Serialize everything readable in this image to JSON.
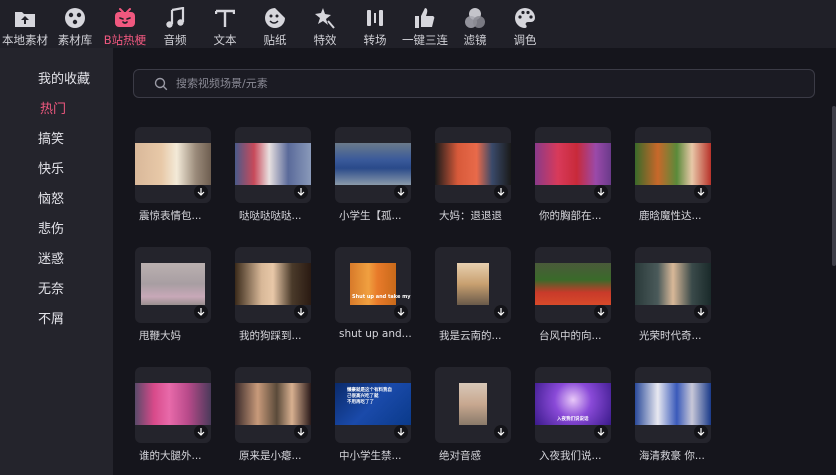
{
  "toolbar": [
    {
      "label": "本地素材",
      "icon": "local-media-icon"
    },
    {
      "label": "素材库",
      "icon": "media-library-icon"
    },
    {
      "label": "B站热梗",
      "icon": "bilibili-tv-icon",
      "active": true
    },
    {
      "label": "音频",
      "icon": "music-note-icon"
    },
    {
      "label": "文本",
      "icon": "text-t-icon"
    },
    {
      "label": "贴纸",
      "icon": "sticker-icon"
    },
    {
      "label": "特效",
      "icon": "effects-star-icon"
    },
    {
      "label": "转场",
      "icon": "transition-icon"
    },
    {
      "label": "一键三连",
      "icon": "thumbs-up-icon"
    },
    {
      "label": "滤镜",
      "icon": "filter-icon"
    },
    {
      "label": "调色",
      "icon": "palette-icon"
    }
  ],
  "sidebar": {
    "items": [
      {
        "label": "我的收藏"
      },
      {
        "label": "热门",
        "active": true
      },
      {
        "label": "搞笑"
      },
      {
        "label": "快乐"
      },
      {
        "label": "恼怒"
      },
      {
        "label": "悲伤"
      },
      {
        "label": "迷惑"
      },
      {
        "label": "无奈"
      },
      {
        "label": "不屑"
      }
    ]
  },
  "search": {
    "placeholder": "搜索视频场景/元素"
  },
  "cards": [
    {
      "caption": "震惊表情包..."
    },
    {
      "caption": "哒哒哒哒哒..."
    },
    {
      "caption": "小学生【孤..."
    },
    {
      "caption": "大妈：退退退"
    },
    {
      "caption": "你的胸部在..."
    },
    {
      "caption": "鹿晗魔性达..."
    },
    {
      "caption": "甩鞭大妈"
    },
    {
      "caption": "我的狗踩到..."
    },
    {
      "caption": "shut up and..."
    },
    {
      "caption": "我是云南的..."
    },
    {
      "caption": "台风中的向..."
    },
    {
      "caption": "光荣时代奇..."
    },
    {
      "caption": "谁的大腿外..."
    },
    {
      "caption": "原来是小瘪..."
    },
    {
      "caption": "中小学生禁..."
    },
    {
      "caption": "绝对音感"
    },
    {
      "caption": "入夜我们说..."
    },
    {
      "caption": "海清救豪 你..."
    }
  ],
  "thumb_texts": {
    "fry": "Shut up and take my",
    "news": "懒豪就是这个有料我自\n己很高兴吃了就\n不用再吃了了",
    "purple": "入夜我们说说话"
  }
}
